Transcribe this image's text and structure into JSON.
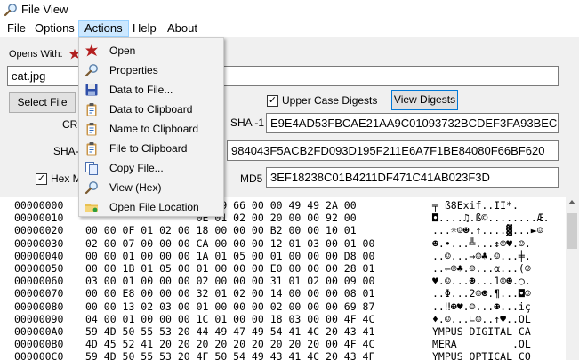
{
  "window": {
    "title": "File View",
    "icon": "magnifier-icon"
  },
  "menubar": [
    "File",
    "Options",
    "Actions",
    "Help",
    "About"
  ],
  "form": {
    "opens_with_label": "Opens With:",
    "file_name": "cat.jpg",
    "select_file_label": "Select File",
    "upper_case_digests_label": "Upper Case Digests",
    "upper_case_digests_checked": true,
    "view_digests_label": "View Digests",
    "crc_label": "CRC",
    "sha_label": "SHA-",
    "hex_mode_label": "Hex M",
    "hex_mode_checked": true,
    "sha1_label": "SHA -1",
    "sha1_value": "E9E4AD53FBCAE21AA9C01093732BCDEF3FA93BEC",
    "sha256_value": "984043F5ACB2FD093D195F211E6A7F1BE84080F66BF620",
    "md5_label": "MD5",
    "md5_value": "3EF18238C01B4211DF471C41AB023F3D"
  },
  "actions_menu": [
    {
      "label": "Open",
      "icon": "red-splash-icon"
    },
    {
      "label": "Properties",
      "icon": "magnifier-icon"
    },
    {
      "label": "Data to File...",
      "icon": "floppy-disk-icon"
    },
    {
      "label": "Data to Clipboard",
      "icon": "clipboard-icon"
    },
    {
      "label": "Name to Clipboard",
      "icon": "clipboard-icon"
    },
    {
      "label": "File to Clipboard",
      "icon": "clipboard-icon"
    },
    {
      "label": "Copy File...",
      "icon": "copy-file-icon"
    },
    {
      "label": "View (Hex)",
      "icon": "magnifier-icon"
    },
    {
      "label": "Open File Location",
      "icon": "folder-icon"
    }
  ],
  "hex_rows": [
    {
      "offset": "00000000",
      "bytes": "                  78 69 66 00 00 49 49 2A 00",
      "ascii": "╤ ß8Exif..II*."
    },
    {
      "offset": "00000010",
      "bytes": "                  0E 01 02 00 20 00 00 92 00",
      "ascii": "◘....♫.ß©........Æ."
    },
    {
      "offset": "00000020",
      "bytes": "00 00 0F 01 02 00 18 00 00 00 B2 00 00 10 01",
      "ascii": "...☼☺☻.↑....▓...►☺"
    },
    {
      "offset": "00000030",
      "bytes": "02 00 07 00 00 00 CA 00 00 00 12 01 03 00 01 00",
      "ascii": "☻.•...╩...↕☺♥.☺."
    },
    {
      "offset": "00000040",
      "bytes": "00 00 01 00 00 00 1A 01 05 00 01 00 00 00 D8 00",
      "ascii": "..☺...→☺♣.☺...╪."
    },
    {
      "offset": "00000050",
      "bytes": "00 00 1B 01 05 00 01 00 00 00 E0 00 00 00 28 01",
      "ascii": "..←☺♣.☺...α...(☺"
    },
    {
      "offset": "00000060",
      "bytes": "03 00 01 00 00 00 02 00 00 00 31 01 02 00 09 00",
      "ascii": "♥.☺...☻...1☺☻.○."
    },
    {
      "offset": "00000070",
      "bytes": "00 00 E8 00 00 00 32 01 02 00 14 00 00 00 08 01",
      "ascii": "..Φ...2☺☻.¶...◘☺"
    },
    {
      "offset": "00000080",
      "bytes": "00 00 13 02 03 00 01 00 00 00 02 00 00 00 69 87",
      "ascii": "..‼☻♥.☺...☻...iç"
    },
    {
      "offset": "00000090",
      "bytes": "04 00 01 00 00 00 1C 01 00 00 18 03 00 00 4F 4C",
      "ascii": "♦.☺...∟☺..↑♥..OL"
    },
    {
      "offset": "000000A0",
      "bytes": "59 4D 50 55 53 20 44 49 47 49 54 41 4C 20 43 41",
      "ascii": "YMPUS DIGITAL CA"
    },
    {
      "offset": "000000B0",
      "bytes": "4D 45 52 41 20 20 20 20 20 20 20 20 20 00 4F 4C",
      "ascii": "MERA         .OL"
    },
    {
      "offset": "000000C0",
      "bytes": "59 4D 50 55 53 20 4F 50 54 49 43 41 4C 20 43 4F",
      "ascii": "YMPUS OPTICAL CO"
    }
  ]
}
